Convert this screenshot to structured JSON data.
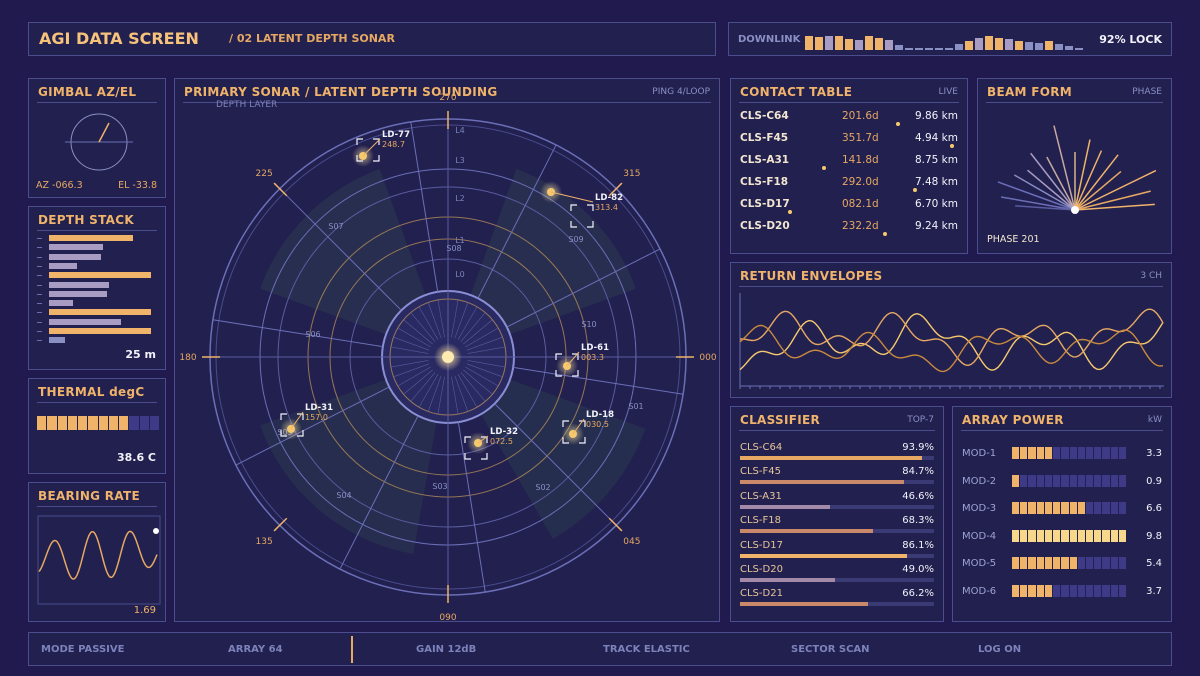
{
  "header": {
    "title": "AGI DATA SCREEN",
    "subtitle": "/ 02 LATENT DEPTH SONAR"
  },
  "downlink": {
    "label": "DOWNLINK",
    "lock": "92% LOCK",
    "bars": [
      0.85,
      0.8,
      0.85,
      0.85,
      0.7,
      0.6,
      0.85,
      0.75,
      0.6,
      0.3,
      0.15,
      0.1,
      0.1,
      0.1,
      0.15,
      0.35,
      0.55,
      0.75,
      0.85,
      0.75,
      0.7,
      0.55,
      0.5,
      0.45,
      0.55,
      0.4,
      0.25,
      0.15
    ]
  },
  "gimbal": {
    "title": "GIMBAL AZ/EL",
    "az": "AZ -066.3",
    "el": "EL -33.8"
  },
  "depth_stack": {
    "title": "DEPTH STACK",
    "value": "25 m",
    "bars": [
      {
        "len": 0.7,
        "color": "#f0b36a"
      },
      {
        "len": 0.45,
        "color": "#a89cc2"
      },
      {
        "len": 0.43,
        "color": "#a89cc2"
      },
      {
        "len": 0.23,
        "color": "#a89cc2"
      },
      {
        "len": 0.85,
        "color": "#f0b36a"
      },
      {
        "len": 0.5,
        "color": "#a89cc2"
      },
      {
        "len": 0.48,
        "color": "#a89cc2"
      },
      {
        "len": 0.2,
        "color": "#a89cc2"
      },
      {
        "len": 0.85,
        "color": "#f0b36a"
      },
      {
        "len": 0.6,
        "color": "#a89cc2"
      },
      {
        "len": 0.85,
        "color": "#f0b36a"
      },
      {
        "len": 0.13,
        "color": "#8a8fc4"
      }
    ]
  },
  "thermal": {
    "title": "THERMAL degC",
    "value": "38.6 C",
    "fill": 0.78
  },
  "bearing_rate": {
    "title": "BEARING RATE",
    "value": "1.69"
  },
  "sonar": {
    "title": "PRIMARY SONAR / LATENT DEPTH SOUNDING",
    "tag": "PING 4/LOOP",
    "depth_label": "DEPTH LAYER",
    "bearings": [
      {
        "label": "270",
        "angle": 270
      },
      {
        "label": "315",
        "angle": 315
      },
      {
        "label": "000",
        "angle": 0
      },
      {
        "label": "045",
        "angle": 45
      },
      {
        "label": "090",
        "angle": 90
      },
      {
        "label": "135",
        "angle": 135
      },
      {
        "label": "180",
        "angle": 180
      },
      {
        "label": "225",
        "angle": 225
      }
    ],
    "layers": [
      "L4",
      "L3",
      "L2",
      "L1",
      "L0"
    ],
    "sectors": [
      "S07",
      "S08",
      "S09",
      "S10",
      "S01",
      "S02",
      "S03",
      "S04",
      "S05",
      "S06"
    ],
    "contacts": [
      {
        "id": "LD-77",
        "bearing": "248.7"
      },
      {
        "id": "LD-82",
        "bearing": "313.4"
      },
      {
        "id": "LD-61",
        "bearing": "003.3"
      },
      {
        "id": "LD-18",
        "bearing": "030.5"
      },
      {
        "id": "LD-32",
        "bearing": "072.5"
      },
      {
        "id": "LD-31",
        "bearing": "157.0"
      }
    ]
  },
  "contact_table": {
    "title": "CONTACT TABLE",
    "tag": "LIVE",
    "rows": [
      {
        "id": "CLS-C64",
        "bearing": "201.6d",
        "range": "9.86 km",
        "dot": 0.72
      },
      {
        "id": "CLS-F45",
        "bearing": "351.7d",
        "range": "4.94 km",
        "dot": 0.97
      },
      {
        "id": "CLS-A31",
        "bearing": "141.8d",
        "range": "8.75 km",
        "dot": 0.38
      },
      {
        "id": "CLS-F18",
        "bearing": "292.0d",
        "range": "7.48 km",
        "dot": 0.8
      },
      {
        "id": "CLS-D17",
        "bearing": "082.1d",
        "range": "6.70 km",
        "dot": 0.22
      },
      {
        "id": "CLS-D20",
        "bearing": "232.2d",
        "range": "9.24 km",
        "dot": 0.66
      }
    ]
  },
  "beam_form": {
    "title": "BEAM FORM",
    "tag": "PHASE",
    "phase": "PHASE 201"
  },
  "return_envelopes": {
    "title": "RETURN ENVELOPES",
    "tag": "3 CH"
  },
  "classifier": {
    "title": "CLASSIFIER",
    "tag": "TOP-7",
    "rows": [
      {
        "id": "CLS-C64",
        "pct": "93.9%",
        "value": 0.939,
        "color": "#e6a862"
      },
      {
        "id": "CLS-F45",
        "pct": "84.7%",
        "value": 0.847,
        "color": "#c9896a"
      },
      {
        "id": "CLS-A31",
        "pct": "46.6%",
        "value": 0.466,
        "color": "#a28aa8"
      },
      {
        "id": "CLS-F18",
        "pct": "68.3%",
        "value": 0.683,
        "color": "#c9896a"
      },
      {
        "id": "CLS-D17",
        "pct": "86.1%",
        "value": 0.861,
        "color": "#f0b36a"
      },
      {
        "id": "CLS-D20",
        "pct": "49.0%",
        "value": 0.49,
        "color": "#a28aa8"
      },
      {
        "id": "CLS-D21",
        "pct": "66.2%",
        "value": 0.662,
        "color": "#c9896a"
      }
    ]
  },
  "array_power": {
    "title": "ARRAY POWER",
    "tag": "kW",
    "rows": [
      {
        "id": "MOD-1",
        "value": "3.3",
        "level": 0.34
      },
      {
        "id": "MOD-2",
        "value": "0.9",
        "level": 0.09
      },
      {
        "id": "MOD-3",
        "value": "6.6",
        "level": 0.67
      },
      {
        "id": "MOD-4",
        "value": "9.8",
        "level": 1.0
      },
      {
        "id": "MOD-5",
        "value": "5.4",
        "level": 0.55
      },
      {
        "id": "MOD-6",
        "value": "3.7",
        "level": 0.38
      }
    ]
  },
  "footer": [
    "MODE PASSIVE",
    "ARRAY 64",
    "GAIN 12dB",
    "TRACK ELASTIC",
    "SECTOR SCAN",
    "LOG ON"
  ],
  "colors": {
    "accent": "#f0b36a",
    "panel": "#22204f",
    "border": "#4a4c8e",
    "bg": "#201a4e"
  }
}
